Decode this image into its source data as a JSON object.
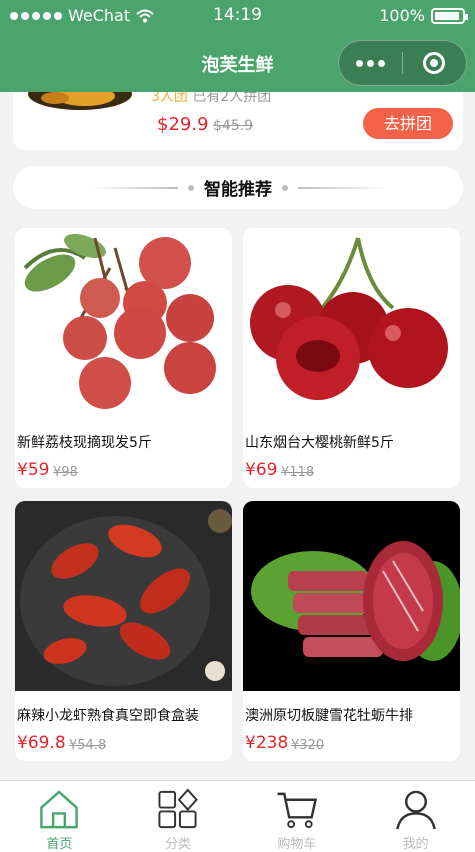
{
  "status_bar": {
    "carrier": "WeChat",
    "time": "14:19",
    "battery": "100%"
  },
  "nav": {
    "title": "泡芙生鲜"
  },
  "group_deal": {
    "meta_people": "3人团",
    "meta_joined": "已有2人拼团",
    "price": "$29.9",
    "old_price": "$45.9",
    "button": "去拼团"
  },
  "recommend": {
    "title": "智能推荐"
  },
  "products": [
    {
      "name": "新鲜荔枝现摘现发5斤",
      "price": "¥59",
      "old_price": "¥98"
    },
    {
      "name": "山东烟台大樱桃新鲜5斤",
      "price": "¥69",
      "old_price": "¥118"
    },
    {
      "name": "麻辣小龙虾熟食真空即食盒装",
      "price": "¥69.8",
      "old_price": "¥54.8"
    },
    {
      "name": "澳洲原切板腱雪花牡蛎牛排",
      "price": "¥238",
      "old_price": "¥320"
    }
  ],
  "tabs": [
    {
      "label": "首页",
      "icon": "home-icon",
      "active": true
    },
    {
      "label": "分类",
      "icon": "category-icon",
      "active": false
    },
    {
      "label": "购物车",
      "icon": "cart-icon",
      "active": false
    },
    {
      "label": "我的",
      "icon": "user-icon",
      "active": false
    }
  ],
  "colors": {
    "brand": "#4aa46b",
    "price": "#e4242b",
    "button": "#f26148"
  }
}
